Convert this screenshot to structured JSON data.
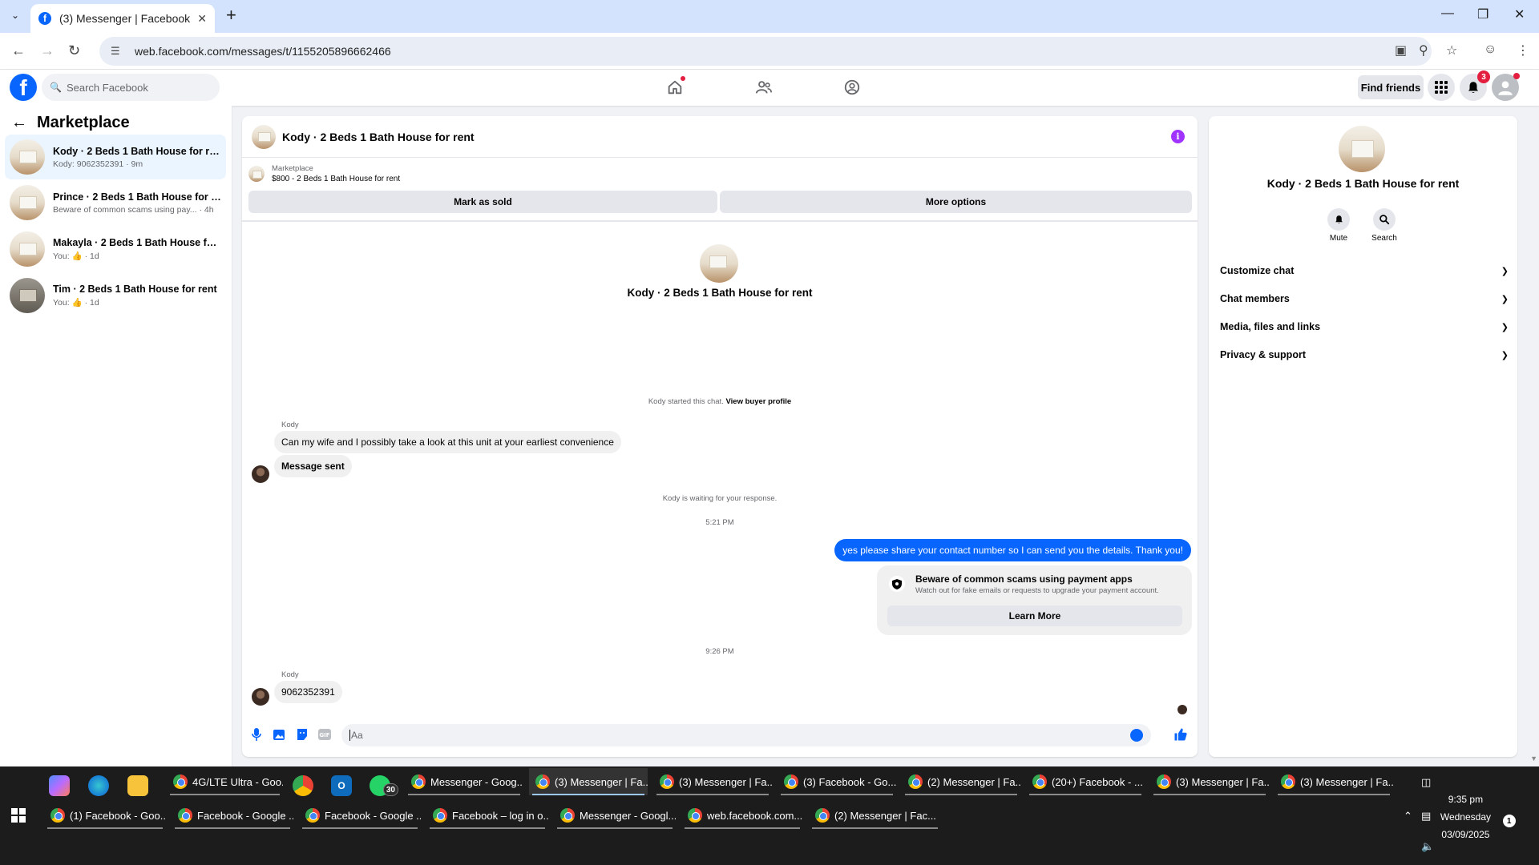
{
  "browser": {
    "tab_title": "(3) Messenger | Facebook",
    "url": "web.facebook.com/messages/t/1155205896662466"
  },
  "fb_header": {
    "search_placeholder": "Search Facebook",
    "find_friends": "Find friends",
    "notification_count": "3"
  },
  "sidebar": {
    "title": "Marketplace",
    "conversations": [
      {
        "name": "Kody · 2 Beds 1 Bath House for rent",
        "sub": "Kody: 9062352391 · 9m",
        "active": true
      },
      {
        "name": "Prince · 2 Beds 1 Bath House for rent",
        "sub": "Beware of common scams using pay... · 4h"
      },
      {
        "name": "Makayla · 2 Beds 1 Bath House for ...",
        "sub_prefix": "You:",
        "sub_suffix": "· 1d"
      },
      {
        "name": "Tim · 2 Beds 1 Bath House for rent",
        "sub_prefix": "You:",
        "sub_suffix": "· 1d"
      }
    ]
  },
  "chat": {
    "title": "Kody · 2 Beds 1 Bath House for rent",
    "marketplace_label": "Marketplace",
    "listing": "$800 - 2 Beds 1 Bath House for rent",
    "mark_sold": "Mark as sold",
    "more_options": "More options",
    "intro_title": "Kody · 2 Beds 1 Bath House for rent",
    "started_text": "Kody started this chat.",
    "view_profile": "View buyer profile",
    "sender_1": "Kody",
    "msg_1": "Can my wife and I possibly take a look at this unit at your earliest convenience",
    "msg_2": "Message sent",
    "waiting_text": "Kody is waiting for your response.",
    "time_1": "5:21 PM",
    "out_msg": "yes please share your contact number so I can send you the details. Thank you!",
    "warn_title": "Beware of common scams using payment apps",
    "warn_sub": "Watch out for fake emails or requests to upgrade your payment account.",
    "learn_more": "Learn More",
    "time_2": "9:26 PM",
    "sender_2": "Kody",
    "msg_3": "9062352391",
    "composer_placeholder": "Aa"
  },
  "right_panel": {
    "title": "Kody · 2 Beds 1 Bath House for rent",
    "mute": "Mute",
    "search": "Search",
    "items": [
      "Customize chat",
      "Chat members",
      "Media, files and links",
      "Privacy & support"
    ]
  },
  "taskbar": {
    "row1": [
      "4G/LTE Ultra - Goo...",
      "Messenger - Goog...",
      "(3) Messenger | Fa...",
      "(3) Messenger | Fa...",
      "(3) Facebook - Go...",
      "(2) Messenger | Fa...",
      "(20+) Facebook - ...",
      "(3) Messenger | Fa...",
      "(3) Messenger | Fa..."
    ],
    "row2": [
      "(1) Facebook - Goo...",
      "Facebook - Google ...",
      "Facebook - Google ...",
      "Facebook – log in o...",
      "Messenger - Googl...",
      "web.facebook.com...",
      "(2) Messenger | Fac..."
    ],
    "whatsapp_badge": "30",
    "time": "9:35 pm",
    "day": "Wednesday",
    "date": "03/09/2025",
    "notif_count": "1"
  },
  "colors": {
    "fb_blue": "#0866ff",
    "notification_red": "#e41e3f",
    "info_purple": "#a033ff"
  }
}
